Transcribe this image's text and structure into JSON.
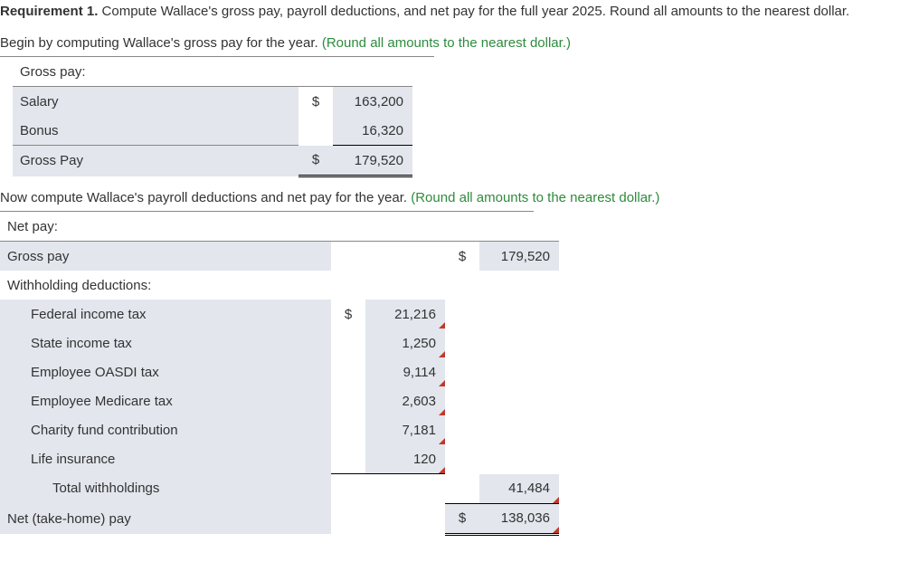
{
  "requirement": {
    "label": "Requirement 1.",
    "text": "Compute Wallace's gross pay, payroll deductions, and net pay for the full year 2025. Round all amounts to the nearest dollar."
  },
  "section1": {
    "intro_text": "Begin by computing Wallace's gross pay for the year.",
    "hint": "(Round all amounts to the nearest dollar.)",
    "header": "Gross pay:",
    "rows": {
      "salary_label": "Salary",
      "salary_dollar": "$",
      "salary_value": "163,200",
      "bonus_label": "Bonus",
      "bonus_value": "16,320",
      "gross_label": "Gross Pay",
      "gross_dollar": "$",
      "gross_value": "179,520"
    }
  },
  "section2": {
    "intro_text": "Now compute Wallace's payroll deductions and net pay for the year.",
    "hint": "(Round all amounts to the nearest dollar.)",
    "net_header": "Net pay:",
    "gross_label": "Gross pay",
    "gross_dollar": "$",
    "gross_value": "179,520",
    "wd_header": "Withholding deductions:",
    "fed_label": "Federal income tax",
    "fed_dollar": "$",
    "fed_value": "21,216",
    "state_label": "State income tax",
    "state_value": "1,250",
    "oasdi_label": "Employee OASDI tax",
    "oasdi_value": "9,114",
    "medicare_label": "Employee Medicare tax",
    "medicare_value": "2,603",
    "charity_label": "Charity fund contribution",
    "charity_value": "7,181",
    "life_label": "Life insurance",
    "life_value": "120",
    "total_label": "Total withholdings",
    "total_value": "41,484",
    "nettake_label": "Net (take-home) pay",
    "nettake_dollar": "$",
    "nettake_value": "138,036"
  }
}
